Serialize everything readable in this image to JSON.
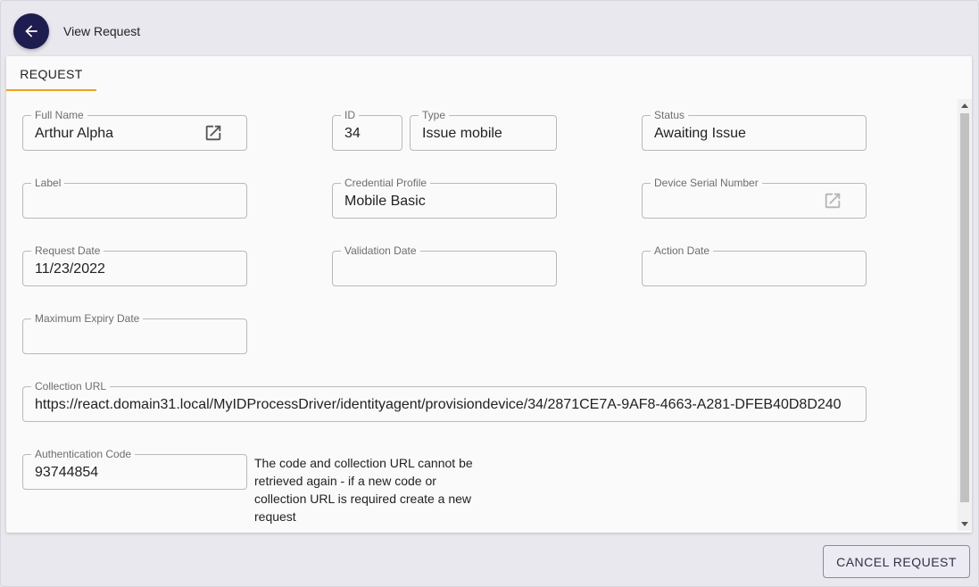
{
  "header": {
    "title": "View Request"
  },
  "icons": {
    "back": "arrow-left-icon",
    "open": "open-in-new-icon"
  },
  "colors": {
    "accent": "#f0a020",
    "back_button": "#1e1d4f"
  },
  "tabs": [
    {
      "label": "REQUEST"
    }
  ],
  "fields": {
    "full_name": {
      "label": "Full Name",
      "value": "Arthur Alpha"
    },
    "id": {
      "label": "ID",
      "value": "34"
    },
    "type": {
      "label": "Type",
      "value": "Issue mobile"
    },
    "status": {
      "label": "Status",
      "value": "Awaiting Issue"
    },
    "label": {
      "label": "Label",
      "value": ""
    },
    "credential_profile": {
      "label": "Credential Profile",
      "value": "Mobile Basic"
    },
    "device_serial_number": {
      "label": "Device Serial Number",
      "value": ""
    },
    "request_date": {
      "label": "Request Date",
      "value": "11/23/2022"
    },
    "validation_date": {
      "label": "Validation Date",
      "value": ""
    },
    "action_date": {
      "label": "Action Date",
      "value": ""
    },
    "maximum_expiry_date": {
      "label": "Maximum Expiry Date",
      "value": ""
    },
    "collection_url": {
      "label": "Collection URL",
      "value": "https://react.domain31.local/MyIDProcessDriver/identityagent/provisiondevice/34/2871CE7A-9AF8-4663-A281-DFEB40D8D240"
    },
    "authentication_code": {
      "label": "Authentication Code",
      "value": "93744854"
    }
  },
  "note": "The code and collection URL cannot be retrieved again - if a new code or collection URL is required create a new request",
  "actions": {
    "cancel_label": "CANCEL REQUEST"
  }
}
